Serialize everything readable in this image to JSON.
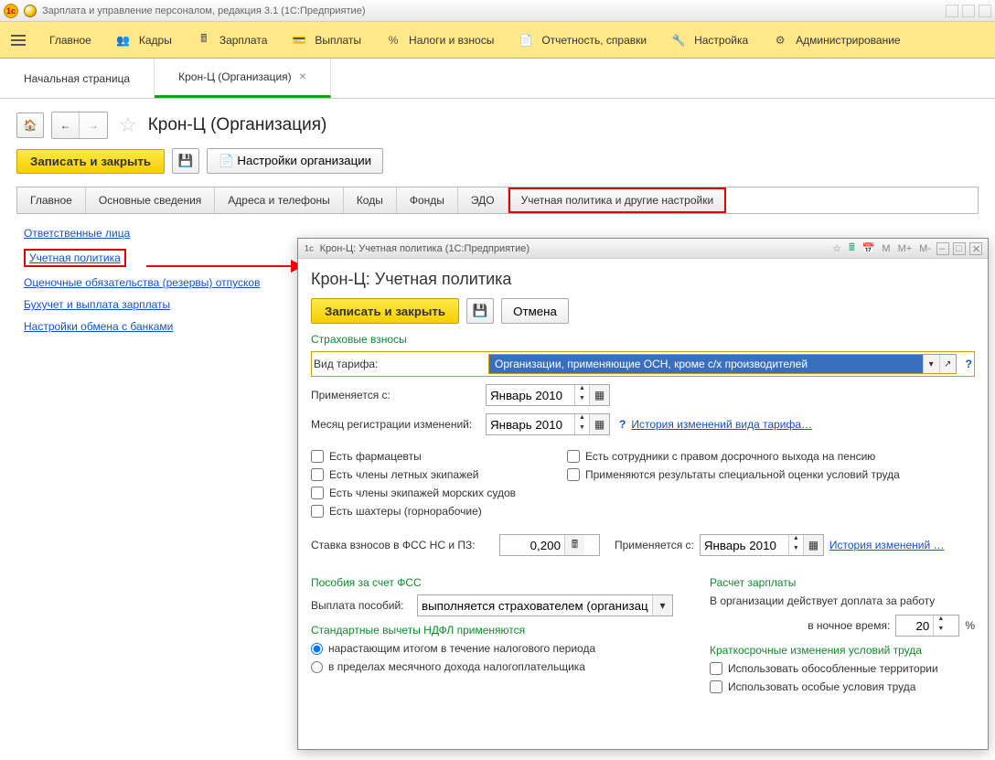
{
  "window": {
    "title": "Зарплата и управление персоналом, редакция 3.1  (1С:Предприятие)"
  },
  "mainmenu": {
    "items": [
      "Главное",
      "Кадры",
      "Зарплата",
      "Выплаты",
      "Налоги и взносы",
      "Отчетность, справки",
      "Настройка",
      "Администрирование"
    ]
  },
  "tabs": {
    "start": "Начальная страница",
    "active": "Крон-Ц (Организация)"
  },
  "page": {
    "title": "Крон-Ц (Организация)"
  },
  "actions": {
    "save_close": "Записать и закрыть",
    "org_settings": "Настройки организации"
  },
  "section_tabs": [
    "Главное",
    "Основные сведения",
    "Адреса и телефоны",
    "Коды",
    "Фонды",
    "ЭДО",
    "Учетная политика и другие настройки"
  ],
  "links": {
    "l1": "Ответственные лица",
    "l2": "Учетная политика",
    "l3": "Оценочные обязательства (резервы) отпусков",
    "l4": "Бухучет и выплата зарплаты",
    "l5": "Настройки обмена с банками"
  },
  "modal": {
    "wintitle": "Крон-Ц: Учетная политика  (1С:Предприятие)",
    "title": "Крон-Ц: Учетная политика",
    "save_close": "Записать и закрыть",
    "cancel": "Отмена",
    "grp_ins": "Страховые взносы",
    "tariff_label": "Вид тарифа:",
    "tariff_value": "Организации, применяющие ОСН, кроме с/х производителей",
    "applies_label": "Применяется с:",
    "applies_value": "Январь 2010",
    "regmonth_label": "Месяц регистрации изменений:",
    "regmonth_value": "Январь 2010",
    "history_tariff": "История изменений вида тарифа…",
    "chk_pharm": "Есть фармацевты",
    "chk_flight": "Есть члены летных экипажей",
    "chk_sea": "Есть члены экипажей морских судов",
    "chk_miners": "Есть шахтеры (горнорабочие)",
    "chk_pension": "Есть сотрудники с правом досрочного выхода на пенсию",
    "chk_sout": "Применяются результаты специальной оценки условий труда",
    "fss_rate_label": "Ставка взносов в ФСС НС и ПЗ:",
    "fss_rate_value": "0,200",
    "applies2_label": "Применяется с:",
    "applies2_value": "Январь 2010",
    "history_link": "История изменений …",
    "grp_fss": "Пособия за счет ФСС",
    "pay_label": "Выплата пособий:",
    "pay_value": "выполняется страхователем (организацией)",
    "grp_ndfl": "Стандартные вычеты НДФЛ применяются",
    "ndfl_r1": "нарастающим итогом в течение налогового периода",
    "ndfl_r2": "в пределах месячного дохода налогоплательщика",
    "grp_salary": "Расчет зарплаты",
    "salary_text1": "В организации действует доплата за работу",
    "salary_text2": "в ночное время:",
    "night_value": "20",
    "percent": "%",
    "grp_short": "Краткосрочные изменения условий труда",
    "chk_terr": "Использовать обособленные территории",
    "chk_spec": "Использовать особые условия труда",
    "mm": "M",
    "mp": "M+",
    "mmn": "M-"
  }
}
